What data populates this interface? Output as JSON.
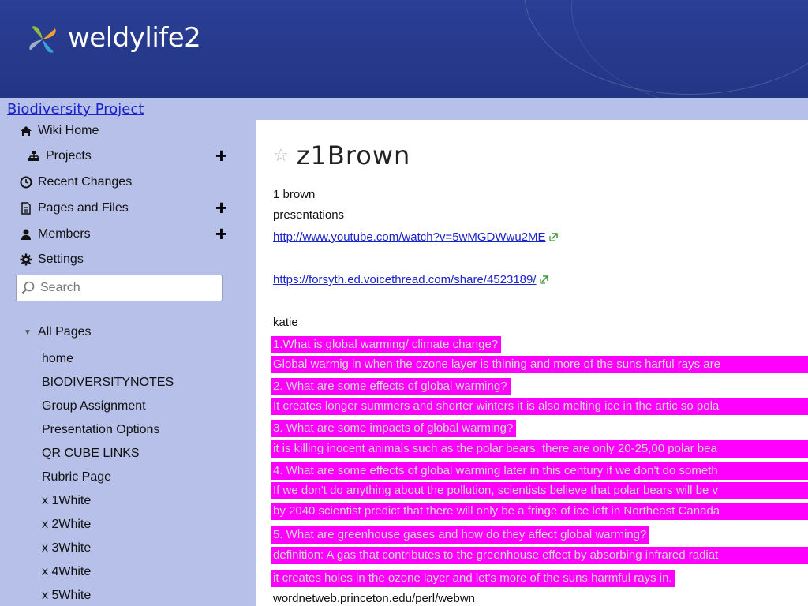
{
  "header": {
    "site_title": "weldylife2",
    "logo_icon": "pinwheel-logo-icon"
  },
  "sidebar": {
    "project_link": "Biodiversity Project",
    "nav": [
      {
        "label": "Wiki Home",
        "icon": "home-icon",
        "plus": false
      },
      {
        "label": "Projects",
        "icon": "sitemap-icon",
        "plus": true
      },
      {
        "label": "Recent Changes",
        "icon": "clock-icon",
        "plus": false
      },
      {
        "label": "Pages and Files",
        "icon": "document-icon",
        "plus": true
      },
      {
        "label": "Members",
        "icon": "user-icon",
        "plus": true
      },
      {
        "label": "Settings",
        "icon": "gear-icon",
        "plus": false
      }
    ],
    "plus_glyph": "+",
    "search_placeholder": "Search",
    "all_pages_label": "All Pages",
    "pages": [
      "home",
      "BIODIVERSITYNOTES",
      "Group Assignment",
      "Presentation Options",
      "QR CUBE LINKS",
      "Rubric Page",
      "x 1White",
      "x 2White",
      "x 3White",
      "x 4White",
      "x 5White"
    ]
  },
  "main": {
    "title": "z1Brown",
    "lines": [
      "1 brown",
      "presentations"
    ],
    "link1": "http://www.youtube.com/watch?v=5wMGDWwu2ME",
    "link2": "https://forsyth.ed.voicethread.com/share/4523189/",
    "author": "katie",
    "highlights": [
      "1.What is global warming/ climate change?",
      "Global warmig in when the ozone layer is thining and more of the suns harful rays are",
      "2. What are some effects of global warming?",
      "It creates longer summers and shorter winters it is also melting ice in the artic so pola",
      "3. What are some impacts of global warming?",
      "it is killing inocent animals such as the polar bears. there are only 20-25,00 polar bea",
      "4. What are some effects of global warming later in this century if we don't do someth",
      "If we don't do anything about the pollution, scientists believe that polar bears will be v",
      "by 2040 scientist predict that there will only be a fringe of ice left in Northeast Canada",
      "5. What are greenhouse gases and how do they affect global warming?",
      "definition: A gas that contributes to the greenhouse effect by absorbing infrared radiat",
      "it creates holes in the ozone layer and let's more of the suns harmful rays in."
    ],
    "footer_line": "wordnetweb.princeton.edu/perl/webwn"
  },
  "colors": {
    "header": "#2a3f95",
    "sidebar": "#b6c0e8",
    "highlight": "#ff00ff",
    "link": "#1a24c8"
  }
}
